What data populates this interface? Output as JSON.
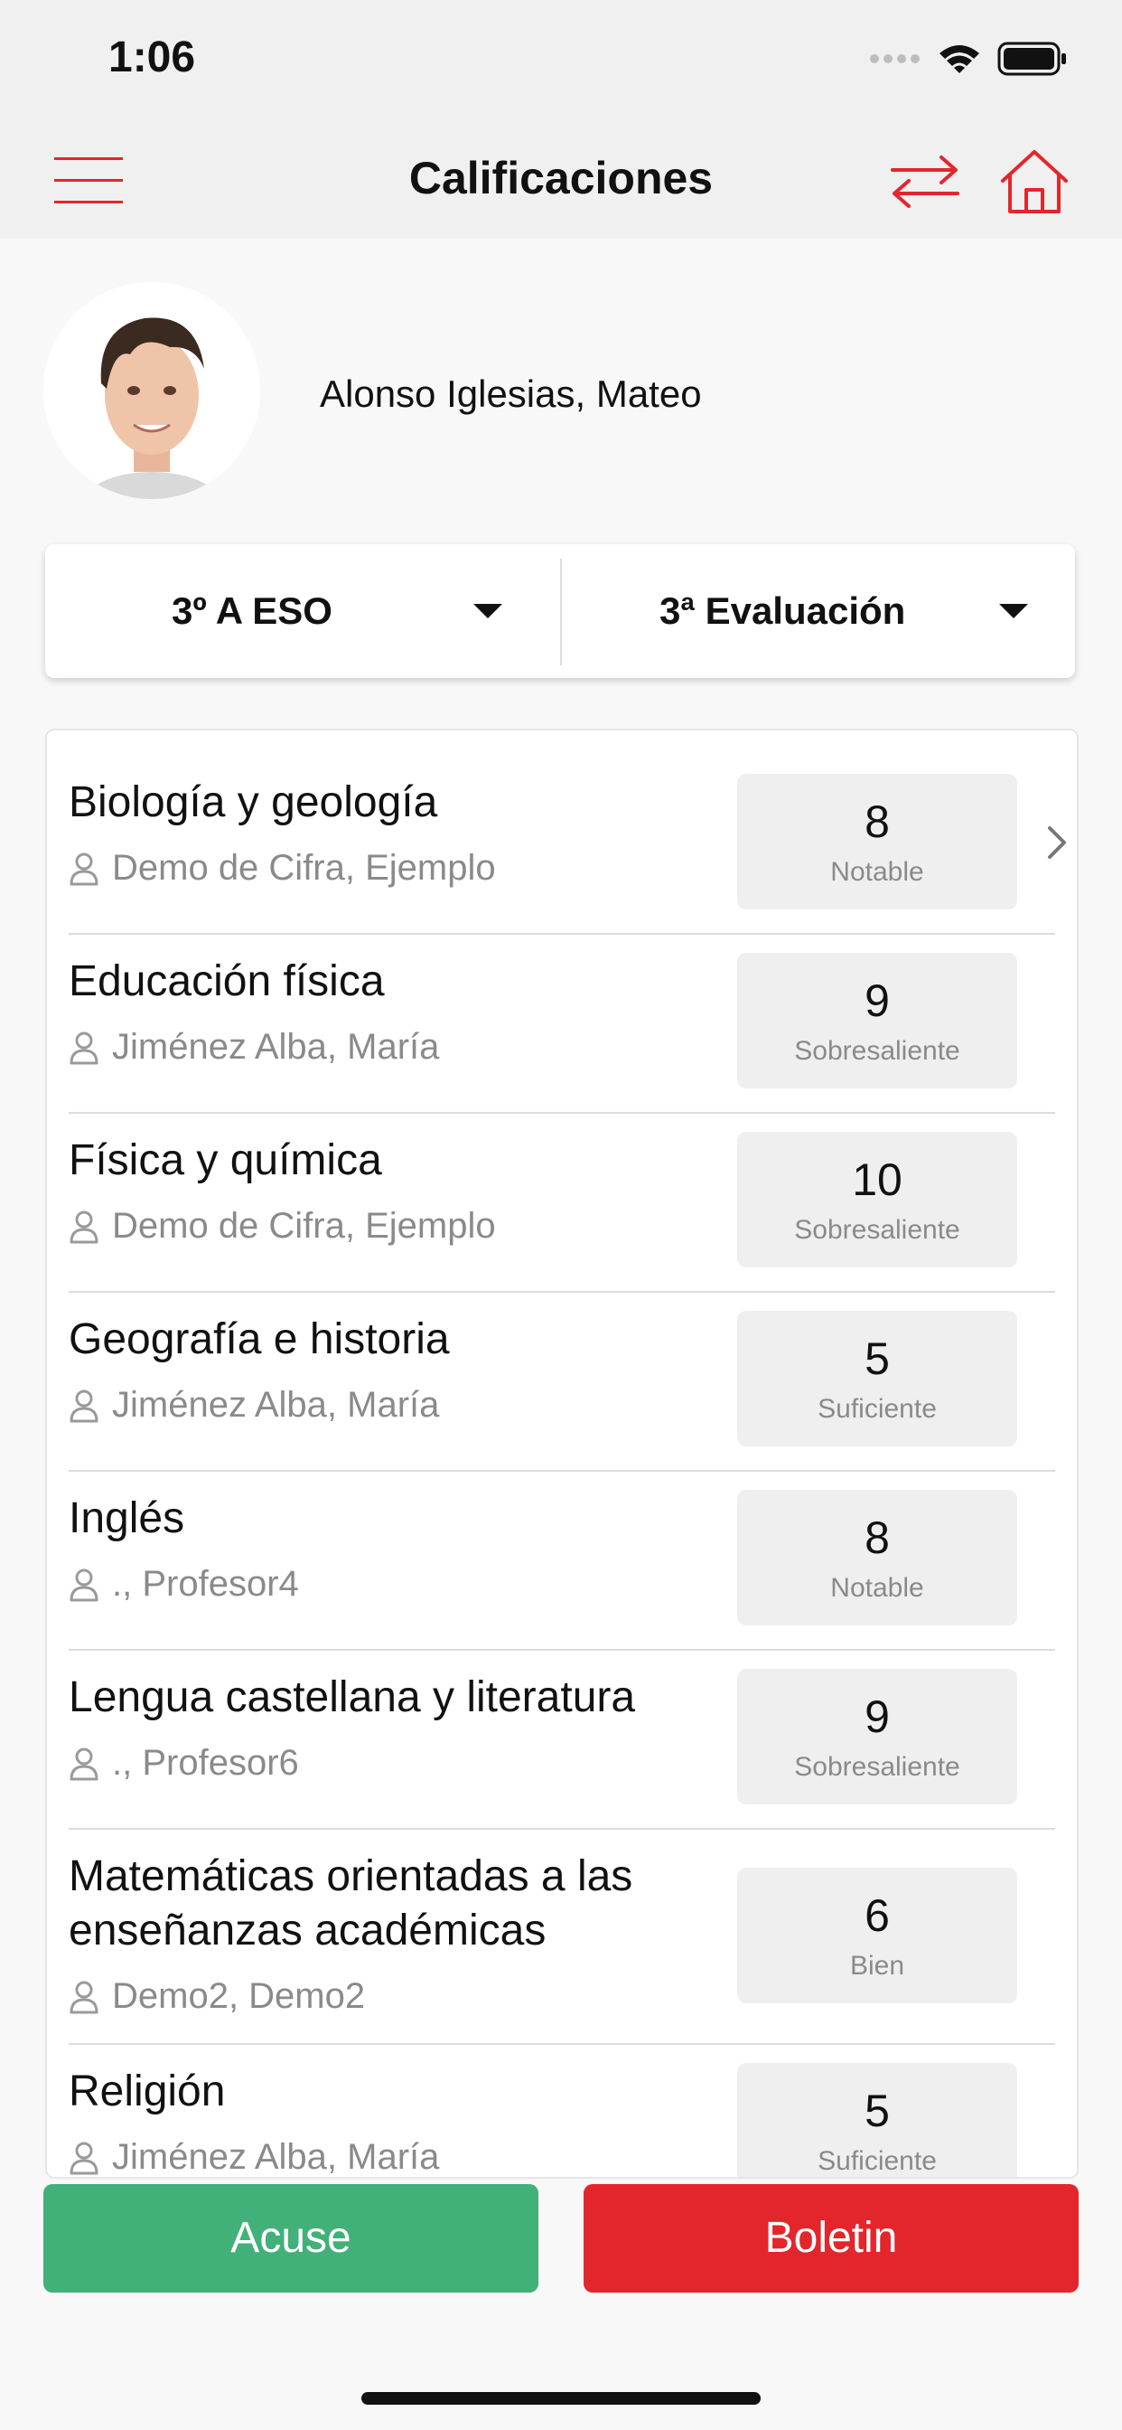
{
  "status_bar": {
    "time": "1:06"
  },
  "header": {
    "title": "Calificaciones"
  },
  "student": {
    "name": "Alonso Iglesias, Mateo"
  },
  "selectors": {
    "group": "3º A ESO",
    "evaluation": "3ª Evaluación"
  },
  "grades": [
    {
      "subject": "Biología y geología",
      "teacher": "Demo de Cifra, Ejemplo",
      "grade": "8",
      "label": "Notable"
    },
    {
      "subject": "Educación física",
      "teacher": "Jiménez Alba, María",
      "grade": "9",
      "label": "Sobresaliente"
    },
    {
      "subject": "Física y química",
      "teacher": "Demo de Cifra, Ejemplo",
      "grade": "10",
      "label": "Sobresaliente"
    },
    {
      "subject": "Geografía e historia",
      "teacher": "Jiménez Alba, María",
      "grade": "5",
      "label": "Suficiente"
    },
    {
      "subject": "Inglés",
      "teacher": "., Profesor4",
      "grade": "8",
      "label": "Notable"
    },
    {
      "subject": "Lengua castellana y literatura",
      "teacher": "., Profesor6",
      "grade": "9",
      "label": "Sobresaliente"
    },
    {
      "subject_line1": "Matemáticas orientadas a las",
      "subject_line2": "enseñanzas académicas",
      "teacher": "Demo2, Demo2",
      "grade": "6",
      "label": "Bien"
    },
    {
      "subject": "Religión",
      "teacher": "Jiménez Alba, María",
      "grade": "5",
      "label": "Suficiente"
    }
  ],
  "actions": {
    "acuse": "Acuse",
    "boletin": "Boletin"
  },
  "colors": {
    "accent_red": "#e3262c",
    "green": "#42b079"
  }
}
